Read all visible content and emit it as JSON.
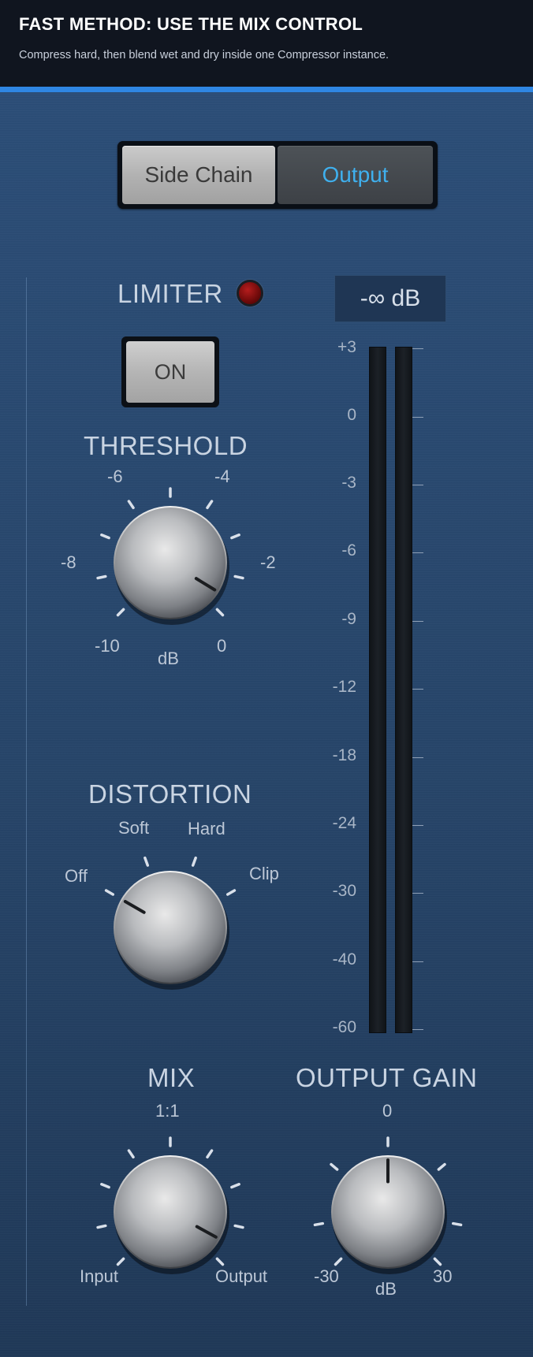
{
  "header": {
    "title": "FAST METHOD: USE THE MIX CONTROL",
    "subtitle": "Compress hard, then blend wet and dry inside one Compressor instance."
  },
  "colors": {
    "accent_bar": "#2f86e3",
    "panel_background": "#264468",
    "selected_tab_text": "#3fb0ee",
    "limiter_led": "#8b0f0f"
  },
  "tabs": {
    "side_chain": "Side Chain",
    "output": "Output",
    "selected": "Output"
  },
  "limiter": {
    "label": "LIMITER",
    "led_state": "off",
    "on_button": "ON"
  },
  "threshold": {
    "label": "THRESHOLD",
    "scale": [
      "-6",
      "-4",
      "-8",
      "-2",
      "-10",
      "0"
    ],
    "unit": "dB",
    "value_db": -0.5
  },
  "distortion": {
    "label": "DISTORTION",
    "options": [
      "Off",
      "Soft",
      "Hard",
      "Clip"
    ],
    "value": "Off"
  },
  "mix": {
    "label": "MIX",
    "center": "1:1",
    "min": "Input",
    "max": "Output",
    "value_fraction": 0.94
  },
  "output_gain": {
    "label": "OUTPUT GAIN",
    "center": "0",
    "min": "-30",
    "max": "30",
    "unit": "dB",
    "value_db": 0
  },
  "meter": {
    "readout": "-∞ dB",
    "scale": [
      "+3",
      "0",
      "-3",
      "-6",
      "-9",
      "-12",
      "-18",
      "-24",
      "-30",
      "-40",
      "-60"
    ],
    "level_fraction": 0
  }
}
